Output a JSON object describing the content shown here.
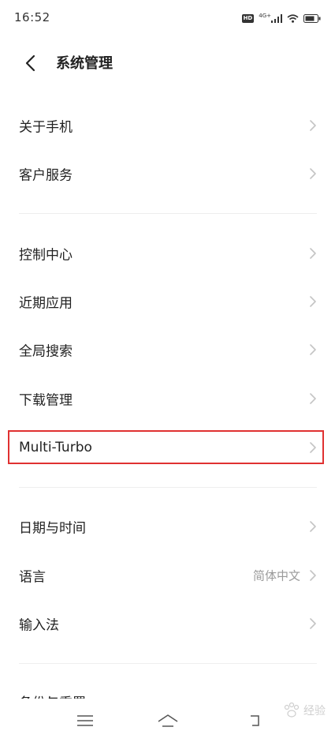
{
  "status_bar": {
    "time": "16:52",
    "hd_badge": "HD",
    "network": "4G+"
  },
  "header": {
    "back_icon": "chevron-left-icon",
    "title": "系统管理"
  },
  "groups": [
    {
      "items": [
        {
          "label": "关于手机"
        },
        {
          "label": "客户服务"
        }
      ]
    },
    {
      "items": [
        {
          "label": "控制中心"
        },
        {
          "label": "近期应用"
        },
        {
          "label": "全局搜索"
        },
        {
          "label": "下载管理"
        },
        {
          "label": "Multi-Turbo",
          "highlighted": true
        }
      ]
    },
    {
      "items": [
        {
          "label": "日期与时间"
        },
        {
          "label": "语言",
          "value": "简体中文"
        },
        {
          "label": "输入法"
        }
      ]
    },
    {
      "items": [
        {
          "label": "备份与重置"
        }
      ]
    }
  ],
  "nav_bar": {
    "menu_icon": "menu-icon",
    "home_icon": "home-icon",
    "back_icon": "back-icon"
  },
  "watermark": {
    "text": "经验"
  },
  "colors": {
    "highlight": "#e03131",
    "chevron": "#c4c4c4",
    "secondary_text": "#9a9a9a"
  }
}
